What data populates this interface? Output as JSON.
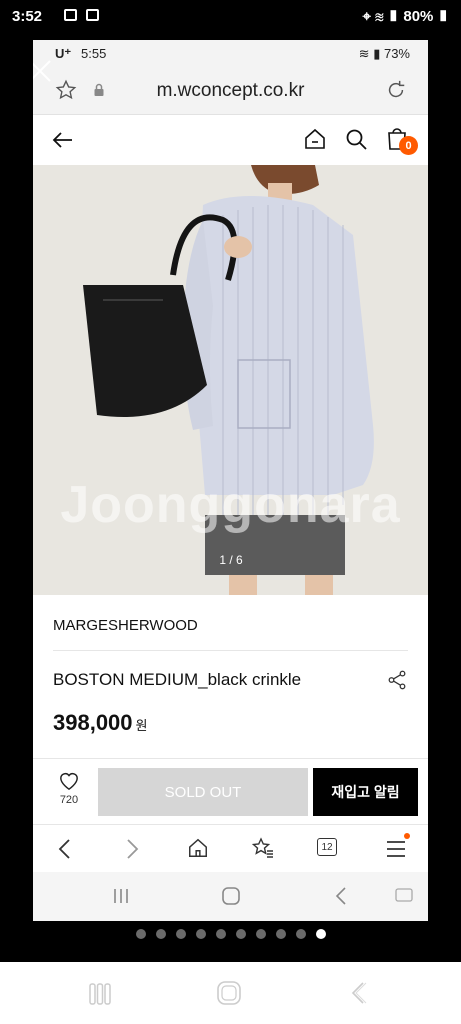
{
  "outer_status": {
    "time": "3:52",
    "battery": "80%"
  },
  "inner_status": {
    "carrier": "U⁺",
    "time": "5:55",
    "battery": "73%"
  },
  "browser": {
    "url": "m.wconcept.co.kr"
  },
  "header": {
    "cart_count": "0"
  },
  "image": {
    "watermark": "Joonggonara",
    "counter": "1 / 6"
  },
  "product": {
    "brand": "MARGESHERWOOD",
    "name": "BOSTON MEDIUM_black crinkle",
    "price": "398,000",
    "currency": "원"
  },
  "actions": {
    "wish_count": "720",
    "sold_out_label": "SOLD OUT",
    "restock_label": "재입고 알림"
  },
  "browser_nav": {
    "tabs_count": "12"
  },
  "pager": {
    "total": 10,
    "active": 10
  },
  "colors": {
    "accent": "#ff5a00",
    "sold_out_bg": "#d6d6d6",
    "restock_bg": "#000000"
  }
}
